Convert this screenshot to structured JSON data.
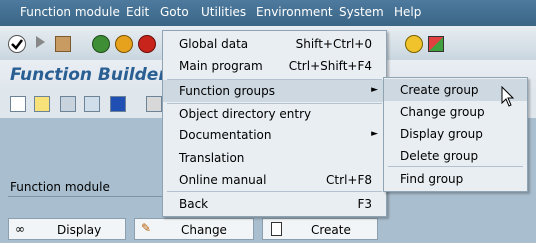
{
  "menubar": {
    "items": [
      "Function module",
      "Edit",
      "Goto",
      "Utilities",
      "Environment",
      "System",
      "Help"
    ]
  },
  "titlebar": {
    "title": "Function Builder:"
  },
  "goto_menu": {
    "items": [
      {
        "label": "Global data",
        "shortcut": "Shift+Ctrl+0"
      },
      {
        "label": "Main program",
        "shortcut": "Ctrl+Shift+F4"
      },
      {
        "label": "Function groups",
        "shortcut": ""
      },
      {
        "label": "Object directory entry",
        "shortcut": ""
      },
      {
        "label": "Documentation",
        "shortcut": ""
      },
      {
        "label": "Translation",
        "shortcut": ""
      },
      {
        "label": "Online manual",
        "shortcut": "Ctrl+F8"
      },
      {
        "label": "Back",
        "shortcut": "F3"
      }
    ]
  },
  "submenu": {
    "items": [
      "Create group",
      "Change group",
      "Display group",
      "Delete group",
      "Find group"
    ]
  },
  "form": {
    "function_module_label": "Function module"
  },
  "buttons": {
    "display": "Display",
    "change": "Change",
    "create": "Create"
  },
  "icons": [
    "check-icon",
    "forward-icon",
    "save-icon",
    "back-icon",
    "exit-icon",
    "cancel-icon",
    "help-icon",
    "layout-icon",
    "trash-icon"
  ]
}
